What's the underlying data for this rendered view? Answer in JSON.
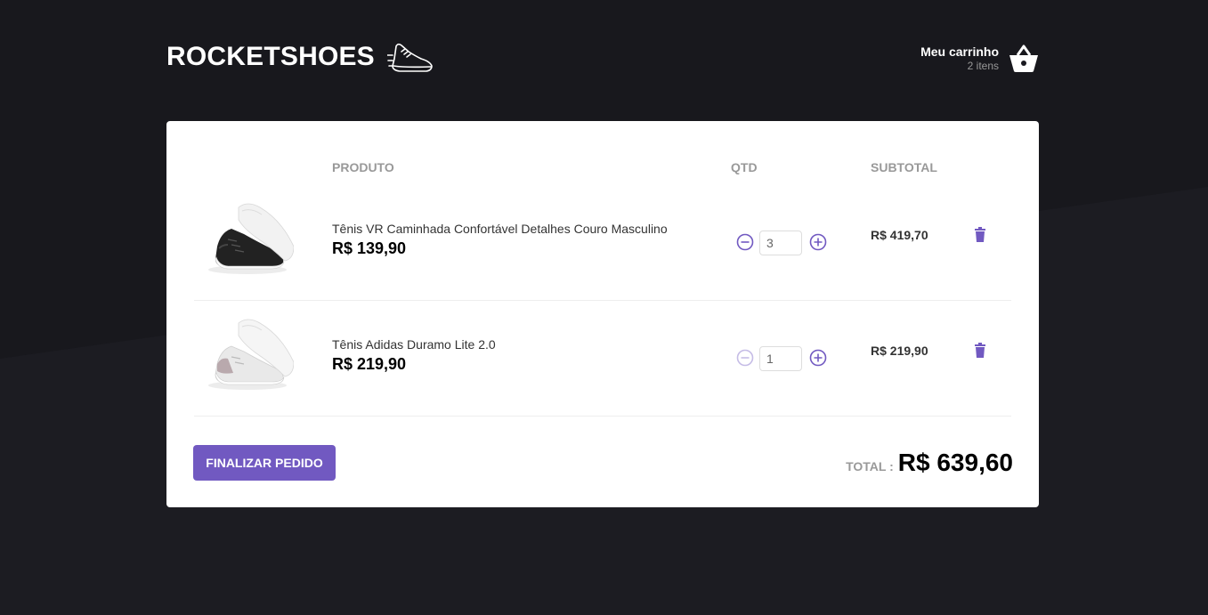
{
  "header": {
    "logo_text": "ROCKETSHOES",
    "logo_icon": "sneaker-icon",
    "cart_title": "Meu carrinho",
    "cart_count": "2 itens",
    "cart_icon": "basket-icon"
  },
  "table": {
    "headers": {
      "product": "PRODUTO",
      "qty": "QTD",
      "subtotal": "SUBTOTAL"
    },
    "rows": [
      {
        "name": "Tênis VR Caminhada Confortável Detalhes Couro Masculino",
        "price": "R$ 139,90",
        "quantity": "3",
        "subtotal": "R$ 419,70",
        "image": "black-sneaker-image"
      },
      {
        "name": "Tênis Adidas Duramo Lite 2.0",
        "price": "R$ 219,90",
        "quantity": "1",
        "subtotal": "R$ 219,90",
        "image": "white-sneaker-image"
      }
    ]
  },
  "footer": {
    "finish_label": "FINALIZAR PEDIDO",
    "total_label": "TOTAL :",
    "total_value": "R$ 639,60"
  },
  "colors": {
    "background": "#191920",
    "accent": "#7159c1",
    "panel": "#ffffff"
  }
}
